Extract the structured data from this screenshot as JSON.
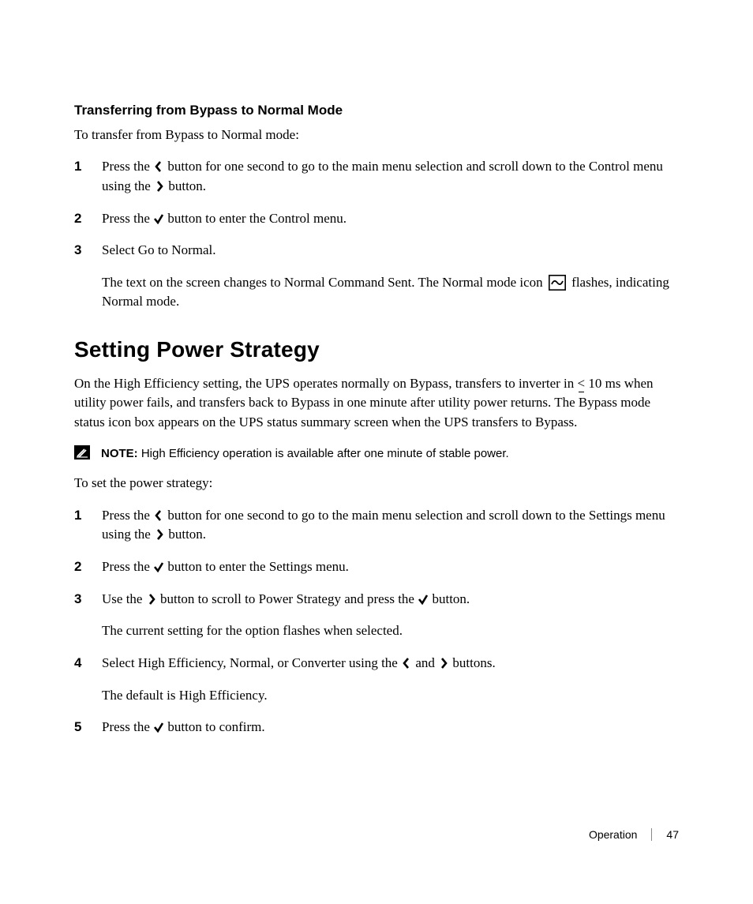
{
  "section1": {
    "heading": "Transferring from Bypass to Normal Mode",
    "intro": "To transfer from Bypass to Normal mode:",
    "steps": {
      "s1a": "Press the ",
      "s1b": " button for one second to go to the main menu selection and scroll down to the Control menu using the ",
      "s1c": " button.",
      "s2a": "Press the ",
      "s2b": " button to enter the Control menu.",
      "s3": "Select Go to Normal.",
      "s3_follow_a": "The text on the screen changes to Normal Command Sent. The Normal mode icon ",
      "s3_follow_b": " flashes, indicating Normal mode."
    },
    "nums": {
      "n1": "1",
      "n2": "2",
      "n3": "3"
    }
  },
  "section2": {
    "heading": "Setting Power Strategy",
    "para_a": "On the High Efficiency setting, the UPS operates normally on Bypass, transfers to inverter in ",
    "para_leq": "<",
    "para_b": " 10 ms when utility power fails, and transfers back to Bypass in one minute after utility power returns. The Bypass mode status icon box appears on the UPS status summary screen when the UPS transfers to Bypass.",
    "note_label": "NOTE:",
    "note_text": " High Efficiency operation is available after one minute of stable power.",
    "intro2": "To set the power strategy:",
    "steps": {
      "s1a": "Press the ",
      "s1b": " button for one second to go to the main menu selection and scroll down to the Settings menu using the ",
      "s1c": " button.",
      "s2a": "Press the ",
      "s2b": " button to enter the Settings menu.",
      "s3a": "Use the ",
      "s3b": " button to scroll to Power Strategy and press the ",
      "s3c": " button.",
      "s3_follow": "The current setting for the option flashes when selected.",
      "s4a": "Select High Efficiency, Normal, or Converter using the ",
      "s4b": " and ",
      "s4c": " buttons.",
      "s4_follow": "The default is High Efficiency.",
      "s5a": "Press the ",
      "s5b": " button to confirm."
    },
    "nums": {
      "n1": "1",
      "n2": "2",
      "n3": "3",
      "n4": "4",
      "n5": "5"
    }
  },
  "footer": {
    "section": "Operation",
    "page": "47"
  }
}
